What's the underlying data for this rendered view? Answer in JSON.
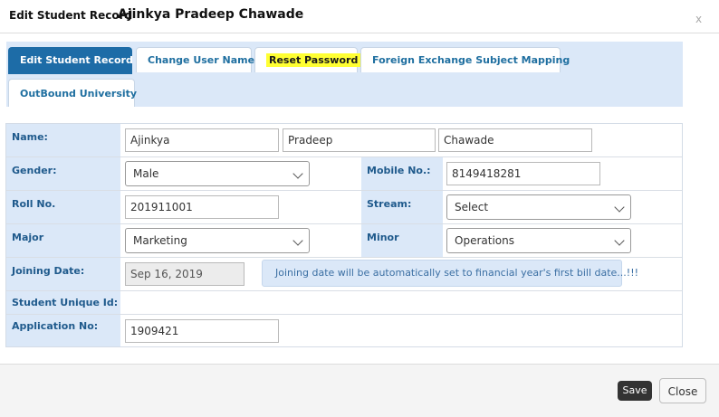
{
  "dialog": {
    "title_prefix": "Edit Student Record",
    "student_name": "Ajinkya Pradeep Chawade",
    "close_glyph": "x"
  },
  "tabs": [
    {
      "label": "Edit Student Record",
      "active": true
    },
    {
      "label": "Change User Name",
      "active": false
    },
    {
      "label": "Reset Password",
      "active": false,
      "highlighted": true
    },
    {
      "label": "Foreign Exchange Subject Mapping",
      "active": false
    },
    {
      "label": "OutBound University",
      "active": false
    }
  ],
  "form": {
    "name": {
      "label": "Name:",
      "first": "Ajinkya",
      "middle": "Pradeep",
      "last": "Chawade"
    },
    "gender": {
      "label": "Gender:",
      "value": "Male"
    },
    "mobile": {
      "label": "Mobile No.:",
      "value": "8149418281"
    },
    "roll": {
      "label": "Roll No.",
      "value": "201911001"
    },
    "stream": {
      "label": "Stream:",
      "value": "Select"
    },
    "major": {
      "label": "Major",
      "value": "Marketing"
    },
    "minor": {
      "label": "Minor",
      "value": "Operations"
    },
    "joining": {
      "label": "Joining Date:",
      "value": "Sep 16, 2019",
      "note": "Joining date will be automatically set to financial year's first bill date...!!!"
    },
    "unique_id": {
      "label": "Student Unique Id:",
      "value": ""
    },
    "application": {
      "label": "Application No:",
      "value": "1909421"
    }
  },
  "footer": {
    "save_label": "Save",
    "close_label": "Close"
  },
  "colors": {
    "accent": "#1d6ca7",
    "label_bg": "#dbe8f8",
    "highlight": "#ffff33",
    "label_text": "#1f5a8c"
  }
}
